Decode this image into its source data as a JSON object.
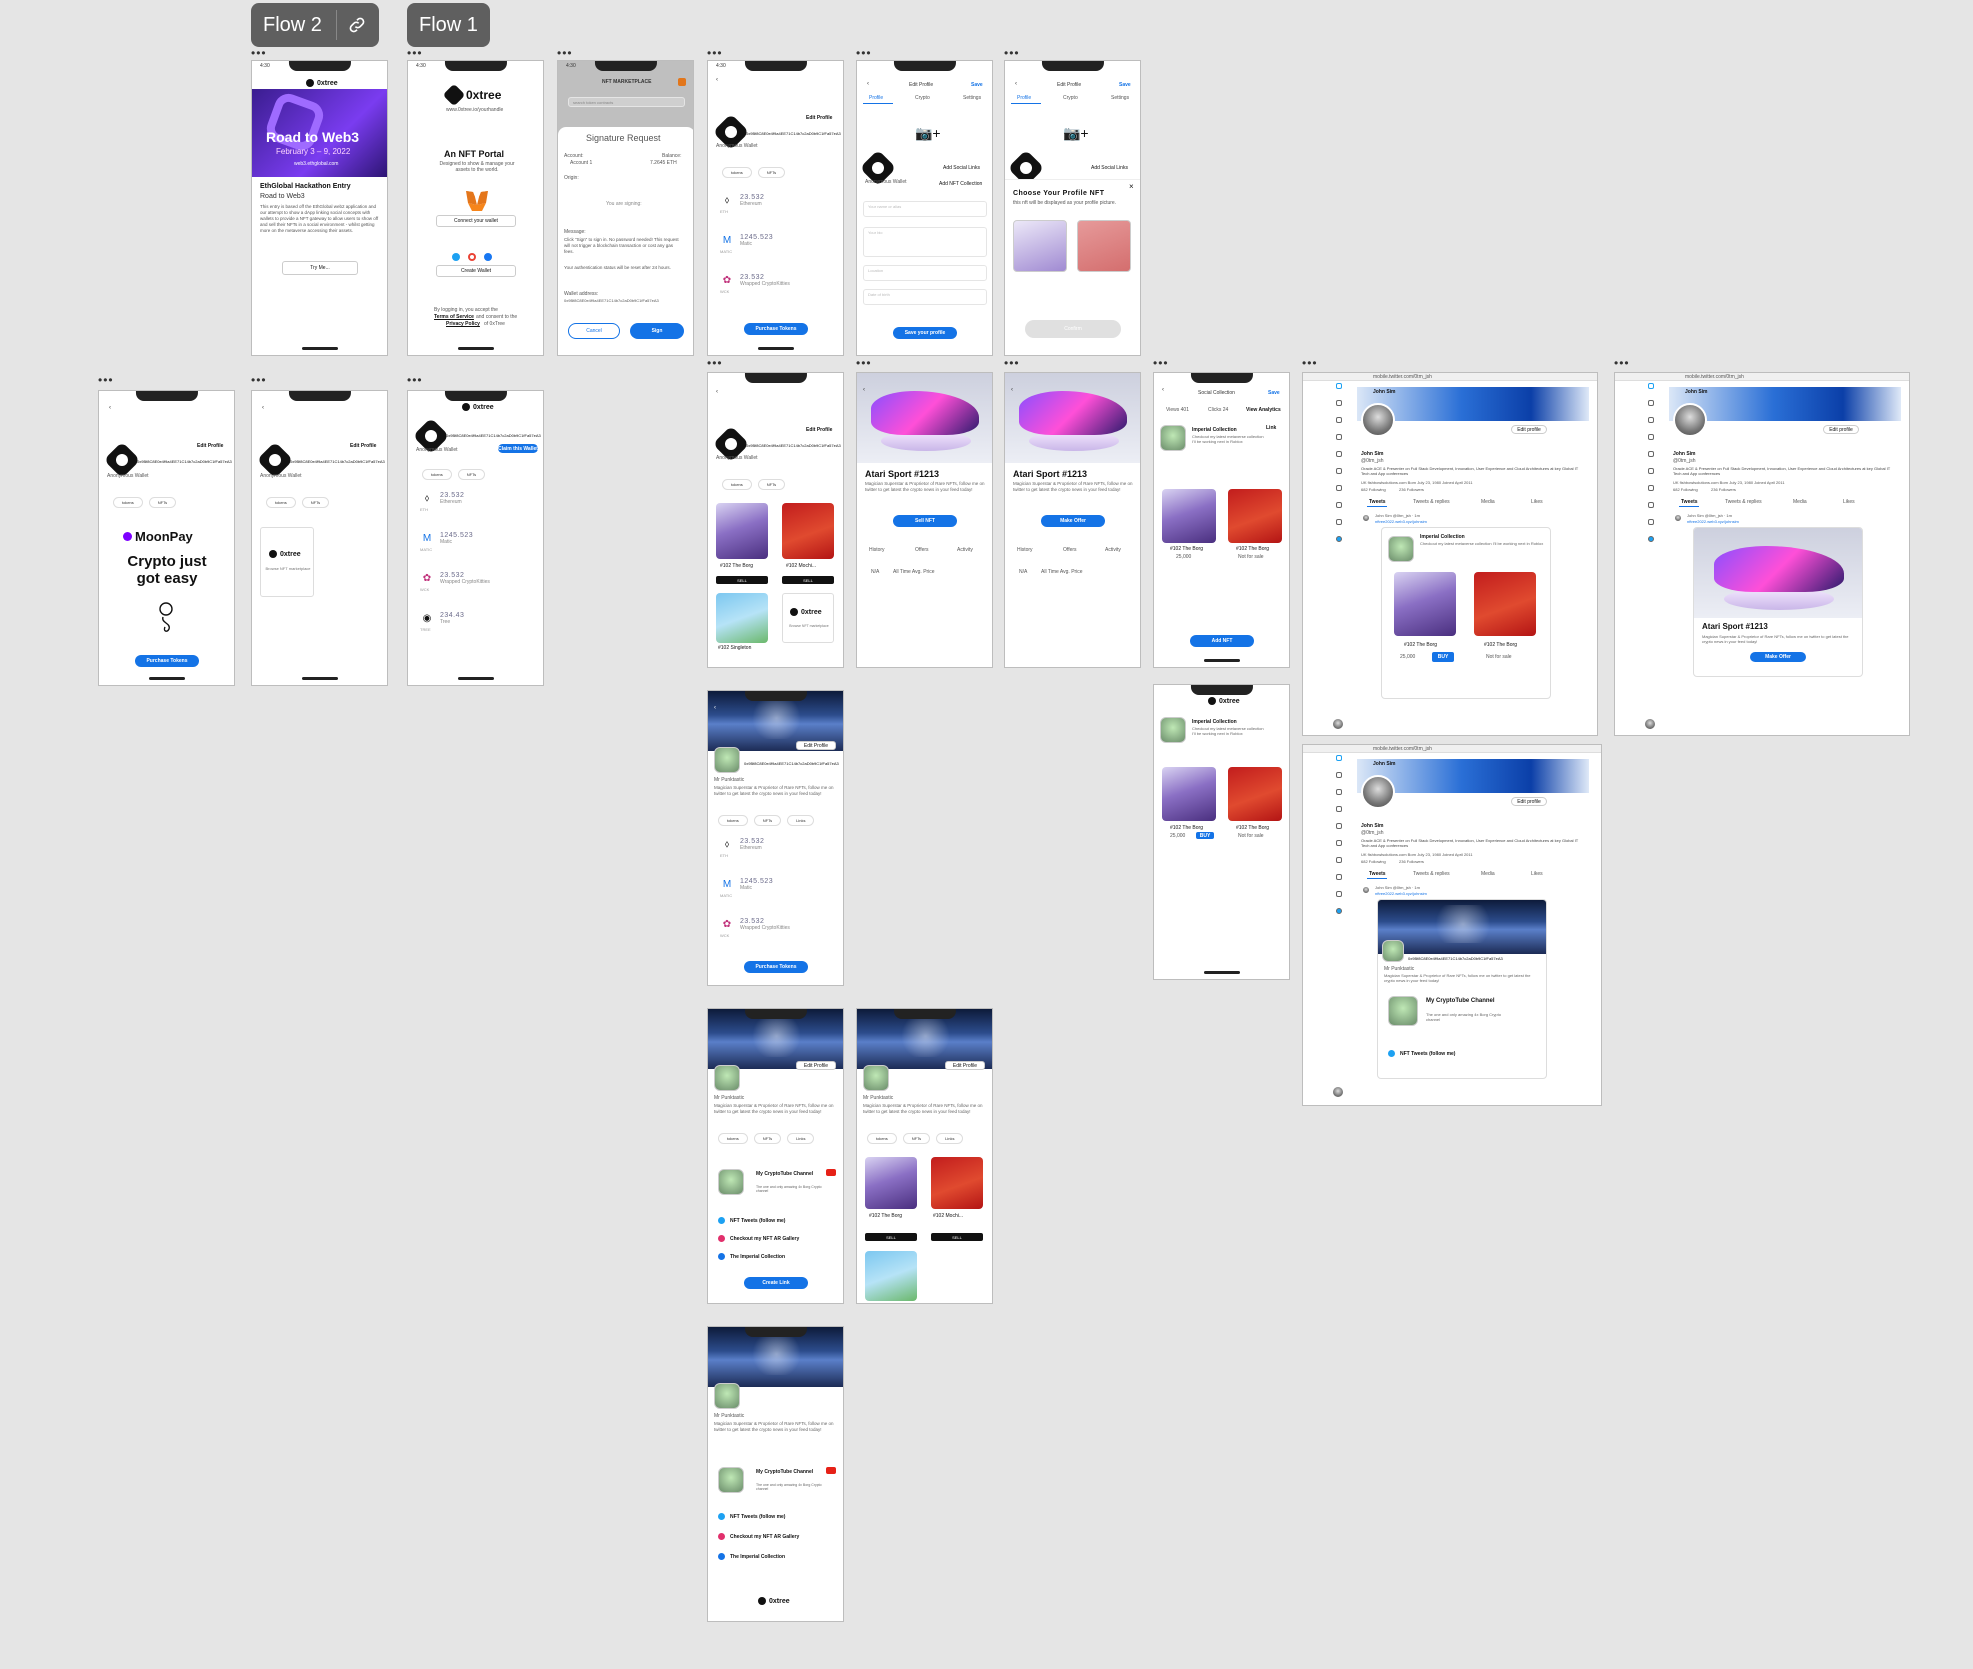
{
  "flows": {
    "flow2": "Flow 2",
    "flow1": "Flow 1"
  },
  "common": {
    "time": "4:30",
    "brand": "0xtree",
    "edit_profile": "Edit Profile",
    "anonymous_wallet": "Anonymous Wallet",
    "wallet_address": "0x9Bf8C8E0e4f9a4EE71C14b7c2aD0b9C1fFa57eA3",
    "purchase_tokens": "Purchase Tokens",
    "tokens_tab": "tokens",
    "nfts_tab": "NFTs",
    "links_tab": "Links",
    "sell": "SELL",
    "more": "•••"
  },
  "coins": [
    {
      "amount": "23.532",
      "name": "Ethereum",
      "symbol": "ETH"
    },
    {
      "amount": "1245.523",
      "name": "Matic",
      "symbol": "MATIC"
    },
    {
      "amount": "23.532",
      "name": "Wrapped CryptoKitties",
      "symbol": "WCK"
    },
    {
      "amount": "234.43",
      "name": "Tree",
      "symbol": "TREE"
    }
  ],
  "nfts": {
    "borg1": "#102 The Borg",
    "borg2": "#102 The Borg",
    "mochi": "#102 Mochi",
    "borg_short": "#102 The Borg",
    "enchant": "#102 Mochi...",
    "singleton": "#102 Singleton",
    "not_for_sale": "Not for sale",
    "price": "25,000",
    "buy": "BUY"
  },
  "hackathon": {
    "banner_title": "Road to Web3",
    "banner_dates": "February 3 – 9, 2022",
    "banner_url": "web3.ethglobal.com",
    "title": "EthGlobal Hackathon Entry",
    "subtitle": "Road to Web3",
    "body": "This entry is based off the EthGlobal web2 application and our attempt to show a dApp linking social concepts with wallets to provide a NFT gateway to allow users to show off and sell their NFTs in a social environment - whilst getting more on the metaverse accessing their assets.",
    "try_me": "Try Me..."
  },
  "portal": {
    "tagline": "www.0xtree.io/yourhandle",
    "title": "An NFT Portal",
    "desc": "Designed to show & manage your assets to the world.",
    "connect": "Connect your wallet",
    "create": "Create Wallet",
    "legal1": "By logging in, you accept the",
    "terms": "Terms of Service",
    "legal2": "and consent to the",
    "privacy": "Privacy Policy",
    "legal3": "of 0xTree"
  },
  "signature": {
    "header": "NFT MARKETPLACE",
    "search": "search token contracts",
    "title": "Signature Request",
    "account_label": "Account:",
    "account": "Account 1",
    "balance_label": "Balance:",
    "balance": "7.2645 ETH",
    "origin": "Origin:",
    "signing": "You are signing:",
    "message": "Message:",
    "msg_body": "Click \"Sign\" to sign in. No password needed! This request will not trigger a blockchain transaction or cost any gas fees.",
    "reset": "Your authentication status will be reset after 24 hours.",
    "wallet_label": "Wallet address:",
    "cancel": "Cancel",
    "sign": "Sign"
  },
  "edit": {
    "title": "Edit Profile",
    "save": "Save",
    "tab_profile": "Profile",
    "tab_crypto": "Crypto",
    "tab_settings": "Settings",
    "add_social": "Add Social Links",
    "add_nft": "Add NFT Collection",
    "f_name": "Your name or alias",
    "f_bio": "Your bio",
    "f_location": "Location",
    "f_date": "Date of birth",
    "save_profile": "Save your profile",
    "choose_title": "Choose Your Profile NFT",
    "choose_desc": "this nft will be displayed as your profile picture.",
    "confirm": "Confirm"
  },
  "moonpay": {
    "brand": "MoonPay",
    "tagline": "Crypto just got easy"
  },
  "connect_wallet_btn": "Claim this Wallet",
  "nft_tree": {
    "brand": "0xtree",
    "caption": "Browse NFT marketplace"
  },
  "sport": {
    "title": "Atari Sport #1213",
    "desc": "Magician Superstar & Proprietor of Rare NFTs, follow me on twitter to get latest the crypto news in your feed today!",
    "sell_nft": "Sell NFT",
    "make_offer": "Make Offer",
    "history": "History",
    "offers": "Offers",
    "activity": "Activity",
    "na": "N/A",
    "avg_price": "All Time Avg. Price"
  },
  "social": {
    "title": "Social Collection",
    "save": "Save",
    "views": "Views 401",
    "clicks": "Clicks 24",
    "analytics": "View Analytics",
    "collection_title": "Imperial Collection",
    "collection_desc": "Checkout my latest metaverse collection I'll be working next in Roblox",
    "link": "Link",
    "add_nft": "Add NFT"
  },
  "profile": {
    "handle": "Mr Punktastic",
    "bio": "Magician Superstar & Proprietor of Rare NFTs, follow me on twitter to get latest the crypto news in your feed today!",
    "channel_title": "My CryptoTube Channel",
    "channel_desc": "The one and only amazing 4x Borg Crypto channel",
    "link_tweets": "NFT Tweets (follow me)",
    "link_gallery": "Checkout my NFT AR Gallery",
    "link_imperial": "The Imperial Collection",
    "create_link": "Create Link"
  },
  "twitter": {
    "url": "mobile.twitter.com/0tm_jsh",
    "name": "John Sim",
    "tweets_count": "1,357 Tweets",
    "handle": "@0tm_jsh",
    "bio": "Oracle ACE & Presenter on Full Stack Development, Innovation, User Experience and Cloud Architectures at key Global IT Tech and App conferences",
    "meta": "UK   fishbowlsolutions.com   Born July 23, 1980   Joined April 2011",
    "following": "682 Following",
    "followers": "236 Followers",
    "edit_profile": "Edit profile",
    "tab_tweets": "Tweets",
    "tab_replies": "Tweets & replies",
    "tab_media": "Media",
    "tab_likes": "Likes",
    "tweet_author": "John Sim @0tm_jsh · 1m",
    "tweet_link": "nftree2022.web3.xyz/johnsim"
  }
}
